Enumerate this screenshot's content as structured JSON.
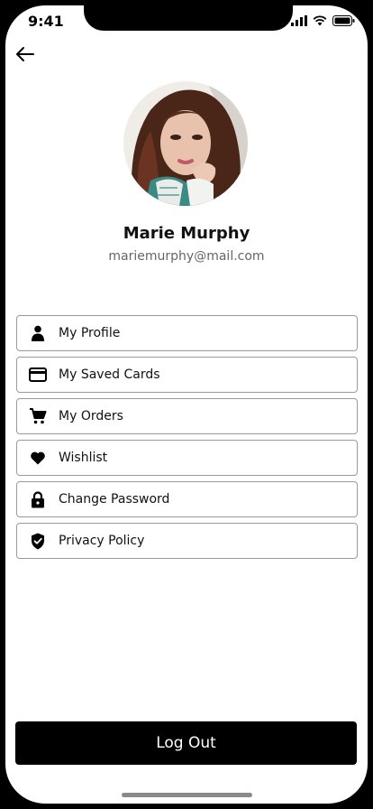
{
  "status": {
    "time": "9:41"
  },
  "profile": {
    "name": "Marie Murphy",
    "email": "mariemurphy@mail.com"
  },
  "menu": [
    {
      "label": "My Profile",
      "icon": "person-icon"
    },
    {
      "label": "My Saved Cards",
      "icon": "credit-card-icon"
    },
    {
      "label": "My Orders",
      "icon": "cart-icon"
    },
    {
      "label": "Wishlist",
      "icon": "heart-icon"
    },
    {
      "label": "Change Password",
      "icon": "lock-icon"
    },
    {
      "label": "Privacy Policy",
      "icon": "shield-check-icon"
    }
  ],
  "actions": {
    "logout": "Log Out"
  },
  "colors": {
    "background": "#ffffff",
    "primary": "#000000",
    "border": "#9a9a9a",
    "muted": "#666666"
  }
}
